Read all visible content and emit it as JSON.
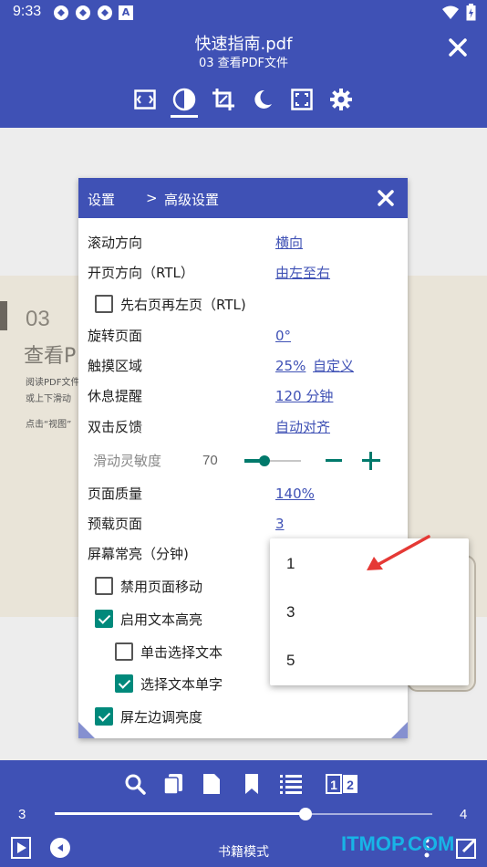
{
  "status_bar": {
    "time": "9:33",
    "app_badge": "A"
  },
  "header": {
    "title": "快速指南.pdf",
    "subtitle": "03 查看PDF文件",
    "toolbar": [
      "fullscreen-icon",
      "contrast-icon",
      "crop-icon",
      "night-mode-icon",
      "fit-icon",
      "settings-icon"
    ]
  },
  "book_page": {
    "number": "03",
    "heading": "查看P",
    "line1": "阅读PDF文件",
    "line2": "或上下滑动",
    "line3": "点击“视图”"
  },
  "dialog": {
    "crumb1": "设置",
    "separator": ">",
    "crumb2": "高级设置",
    "rows": {
      "scroll_direction": {
        "label": "滚动方向",
        "value": "横向"
      },
      "page_direction": {
        "label": "开页方向（RTL）",
        "value": "由左至右"
      },
      "right_first": {
        "label": "先右页再左页（RTL)",
        "checked": false
      },
      "rotate": {
        "label": "旋转页面",
        "value": "0°"
      },
      "touch_area": {
        "label": "触摸区域",
        "value": "25%",
        "value2": "自定义"
      },
      "rest_reminder": {
        "label": "休息提醒",
        "value": "120 分钟"
      },
      "double_tap": {
        "label": "双击反馈",
        "value": "自动对齐"
      },
      "sensitivity": {
        "label": "滑动灵敏度",
        "value": "70",
        "level": 0.35
      },
      "page_quality": {
        "label": "页面质量",
        "value": "140%"
      },
      "preload": {
        "label": "预载页面",
        "value": "3"
      },
      "screen_on": {
        "label": "屏幕常亮（分钟)"
      },
      "disable_move": {
        "label": "禁用页面移动",
        "checked": false
      },
      "text_highlight": {
        "label": "启用文本高亮",
        "checked": true
      },
      "tap_select": {
        "label": "单击选择文本",
        "checked": false
      },
      "select_word": {
        "label": "选择文本单字",
        "checked": true
      },
      "left_brightness": {
        "label": "屏左边调亮度",
        "checked": true
      }
    }
  },
  "popup": {
    "options": [
      "1",
      "3",
      "5"
    ]
  },
  "bottom": {
    "icons": [
      "search-icon",
      "copy-icon",
      "page-icon",
      "bookmark-icon",
      "list-icon",
      "dual-page-icon"
    ],
    "page_start": "3",
    "page_end": "4",
    "progress": 0.665,
    "mode": "书籍模式"
  },
  "watermark": "ITMOP.COM",
  "colors": {
    "primary": "#3f51b5",
    "accent": "#00796b",
    "link": "#3f51b5"
  }
}
